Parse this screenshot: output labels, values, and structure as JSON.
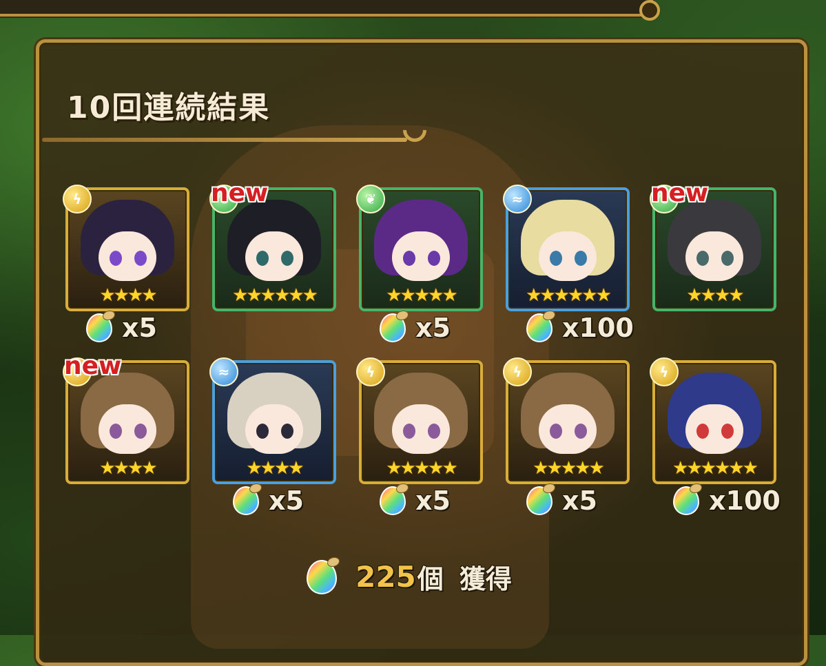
{
  "title": "10回連続結果",
  "new_label": "new",
  "results": [
    {
      "element": "light",
      "hair": "#2b2240",
      "eye": "#7a4ac8",
      "stars": "★★★★",
      "is_new": false,
      "reward": "x5"
    },
    {
      "element": "wood",
      "hair": "#1e1e26",
      "eye": "#2f6a6a",
      "stars": "★★★★★★",
      "is_new": true,
      "reward": ""
    },
    {
      "element": "wood",
      "hair": "#5a2a86",
      "eye": "#6a3aa8",
      "stars": "★★★★★",
      "is_new": false,
      "reward": "x5"
    },
    {
      "element": "water",
      "hair": "#e8dca0",
      "eye": "#3a7aa8",
      "stars": "★★★★★★",
      "is_new": false,
      "reward": "x100"
    },
    {
      "element": "wood",
      "hair": "#3a3a3e",
      "eye": "#4a6a6a",
      "stars": "★★★★",
      "is_new": true,
      "reward": ""
    },
    {
      "element": "light",
      "hair": "#8a6a44",
      "eye": "#8a5a9a",
      "stars": "★★★★",
      "is_new": true,
      "reward": ""
    },
    {
      "element": "water",
      "hair": "#d8d0c0",
      "eye": "#2a2a3a",
      "stars": "★★★★",
      "is_new": false,
      "reward": "x5"
    },
    {
      "element": "light",
      "hair": "#8a6a44",
      "eye": "#8a5a9a",
      "stars": "★★★★★",
      "is_new": false,
      "reward": "x5"
    },
    {
      "element": "light",
      "hair": "#8a6a44",
      "eye": "#8a5a9a",
      "stars": "★★★★★",
      "is_new": false,
      "reward": "x5"
    },
    {
      "element": "light",
      "hair": "#2f3a8a",
      "eye": "#d03a3a",
      "stars": "★★★★★★",
      "is_new": false,
      "reward": "x100"
    }
  ],
  "total": {
    "amount": "225",
    "unit": "個",
    "label": "獲得"
  },
  "colors": {
    "frame_gold": "#d9ad3a",
    "frame_green": "#45b56c",
    "frame_blue": "#4a9fe0",
    "total_amount": "#f2c24a",
    "star": "#ffd52a"
  }
}
